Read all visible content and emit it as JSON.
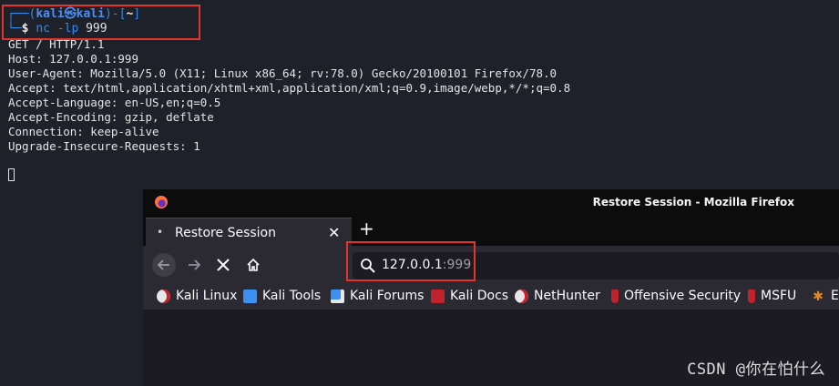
{
  "terminal": {
    "prompt": {
      "corner_top": "┌──(",
      "user": "kali",
      "at": "㉿",
      "host": "kali",
      "bracket_mid": ")-[",
      "dir": "~",
      "bracket_end": "]",
      "corner_bottom": "└─",
      "dollar": "$",
      "command": "nc",
      "flag": "-lp",
      "port": "999"
    },
    "output_lines": [
      "GET / HTTP/1.1",
      "Host: 127.0.0.1:999",
      "User-Agent: Mozilla/5.0 (X11; Linux x86_64; rv:78.0) Gecko/20100101 Firefox/78.0",
      "Accept: text/html,application/xhtml+xml,application/xml;q=0.9,image/webp,*/*;q=0.8",
      "Accept-Language: en-US,en;q=0.5",
      "Accept-Encoding: gzip, deflate",
      "Connection: keep-alive",
      "Upgrade-Insecure-Requests: 1"
    ]
  },
  "firefox": {
    "window_title": "Restore Session - Mozilla Firefox",
    "tab": {
      "label": "Restore Session",
      "close": "✕"
    },
    "new_tab": "+",
    "url": {
      "host": "127.0.0.1",
      "port": ":999"
    },
    "bookmarks": [
      {
        "label": "Kali Linux",
        "icon": "kali-icon"
      },
      {
        "label": "Kali Tools",
        "icon": "kali-tools-icon"
      },
      {
        "label": "Kali Forums",
        "icon": "kali-forums-icon"
      },
      {
        "label": "Kali Docs",
        "icon": "kali-docs-icon"
      },
      {
        "label": "NetHunter",
        "icon": "nethunter-icon"
      },
      {
        "label": "Offensive Security",
        "icon": "offsec-icon"
      },
      {
        "label": "MSFU",
        "icon": "msfu-icon"
      },
      {
        "label": "E",
        "icon": "exploit-db-icon"
      }
    ]
  },
  "watermark": "CSDN @你在怕什么",
  "colors": {
    "highlight": "#e5342c",
    "terminal_bg": "#1e2129",
    "prompt_blue": "#2f8bf0"
  }
}
